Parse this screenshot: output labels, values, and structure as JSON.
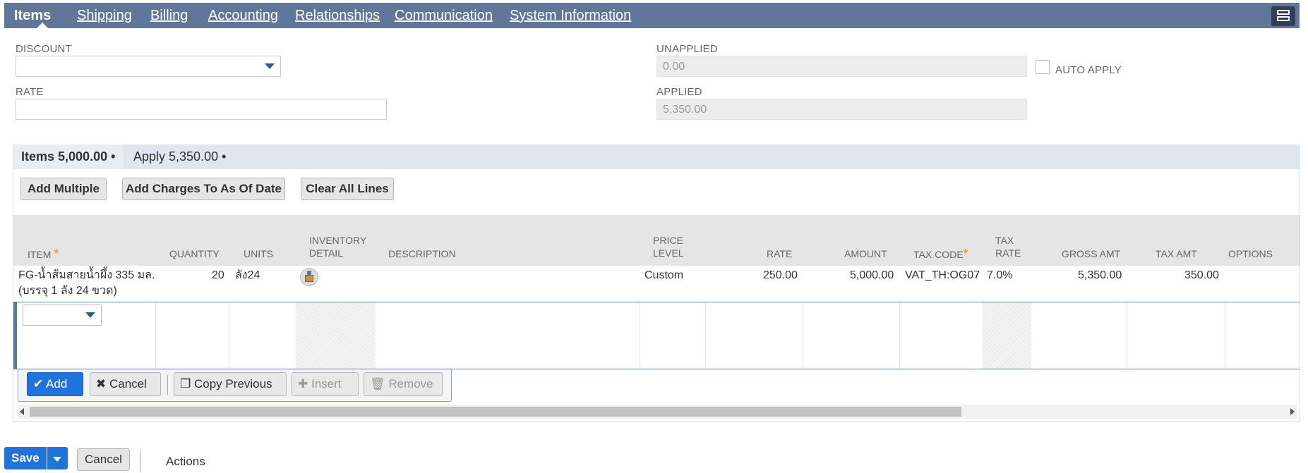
{
  "tabs": {
    "items": [
      {
        "label": "Items",
        "active": true
      },
      {
        "label": "Shipping"
      },
      {
        "label": "Billing"
      },
      {
        "label": "Accounting"
      },
      {
        "label": "Relationships"
      },
      {
        "label": "Communication"
      },
      {
        "label": "System Information"
      }
    ]
  },
  "fields": {
    "discount": {
      "label": "DISCOUNT",
      "value": ""
    },
    "rate": {
      "label": "RATE",
      "value": ""
    },
    "unapplied": {
      "label": "UNAPPLIED",
      "value": "0.00"
    },
    "applied": {
      "label": "APPLIED",
      "value": "5,350.00"
    },
    "auto_apply": {
      "label": "AUTO APPLY",
      "checked": false
    }
  },
  "subtabs": {
    "items": "Items 5,000.00 •",
    "apply": "Apply 5,350.00 •"
  },
  "toolbar": {
    "add_multiple": "Add Multiple",
    "add_charges": "Add Charges To As Of Date",
    "clear_all": "Clear All Lines"
  },
  "grid": {
    "headers": {
      "item": "ITEM",
      "quantity": "QUANTITY",
      "units": "UNITS",
      "inventory_1": "INVENTORY",
      "inventory_2": "DETAIL",
      "description": "DESCRIPTION",
      "price_1": "PRICE",
      "price_2": "LEVEL",
      "rate": "RATE",
      "amount": "AMOUNT",
      "tax_code": "TAX CODE",
      "tax_rate_1": "TAX",
      "tax_rate_2": "RATE",
      "gross_amt": "GROSS AMT",
      "tax_amt": "TAX AMT",
      "options": "OPTIONS"
    },
    "row": {
      "item_1": "FG-น้ำส้มสายน้ำผึ้ง 335 มล.",
      "item_2": "(บรรจุ 1 ลัง 24 ขวด)",
      "quantity": "20",
      "units": "ลัง24",
      "price_level": "Custom",
      "rate": "250.00",
      "amount": "5,000.00",
      "tax_code": "VAT_TH:OG07",
      "tax_rate": "7.0%",
      "gross_amt": "5,350.00",
      "tax_amt": "350.00"
    }
  },
  "line_actions": {
    "add": "Add",
    "cancel": "Cancel",
    "copy_previous": "Copy Previous",
    "insert": "Insert",
    "remove": "Remove"
  },
  "footer": {
    "save": "Save",
    "cancel": "Cancel",
    "actions": "Actions"
  },
  "colors": {
    "tabbar": "#607799",
    "primary": "#1f73d9",
    "required_star": "#e38f1f"
  }
}
